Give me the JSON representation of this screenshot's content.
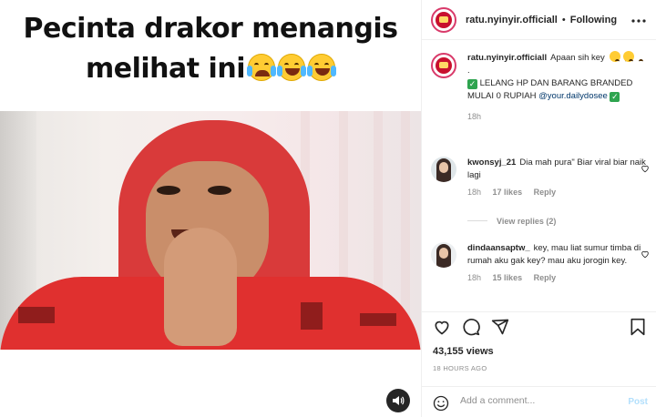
{
  "video": {
    "caption_line1": "Pecinta drakor menangis",
    "caption_line2": "melihat ini",
    "caption_emojis": [
      "loudly-crying-face",
      "face-with-tears-of-joy",
      "face-with-tears-of-joy"
    ],
    "audio_icon": "speaker-icon"
  },
  "header": {
    "username": "ratu.nyinyir.officiall",
    "separator": "•",
    "follow_state": "Following",
    "more_icon": "ellipsis-icon"
  },
  "post": {
    "username": "ratu.nyinyir.officiall",
    "text_line1": "Apaan sih key",
    "text_line2": ".",
    "text_line3": "LELANG HP DAN BARANG BRANDED",
    "text_line4_prefix": "MULAI 0 RUPIAH ",
    "mention": "@your.dailydosee",
    "time": "18h"
  },
  "comments": [
    {
      "username": "kwonsyj_21",
      "text": "Dia mah pura\" Biar viral biar naik lagi",
      "time": "18h",
      "likes": "17 likes",
      "reply": "Reply",
      "view_replies": "View replies (2)"
    },
    {
      "username": "dindaansaptw_",
      "text": "key, mau liat sumur timba di rumah aku gak key? mau aku jorogin key.",
      "time": "18h",
      "likes": "15 likes",
      "reply": "Reply"
    }
  ],
  "stats": {
    "views": "43,155 views",
    "ago": "18 HOURS AGO"
  },
  "composer": {
    "placeholder": "Add a comment...",
    "post_label": "Post"
  },
  "colors": {
    "accent": "#0095f6",
    "post_disabled": "#b2dffc",
    "like_green_check": "#2ea44f"
  }
}
